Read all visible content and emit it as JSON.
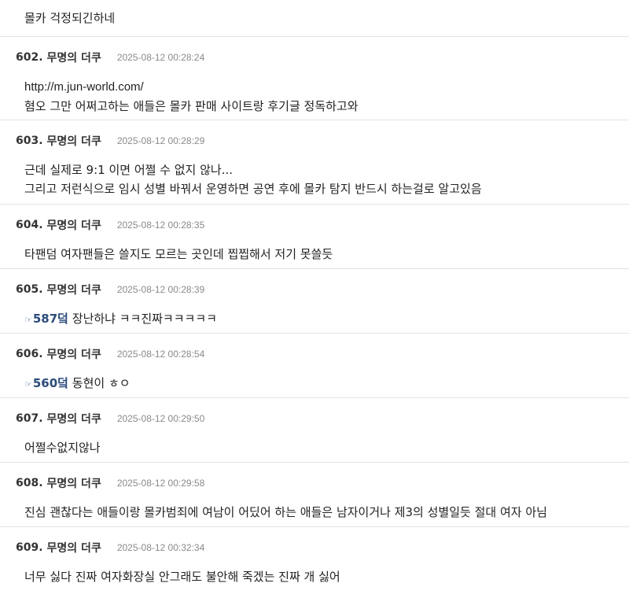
{
  "top_post": {
    "text": "몰카 걱정되긴하네"
  },
  "posts": [
    {
      "number": "602.",
      "author": "무명의 더쿠",
      "time": "2025-08-12 00:28:24",
      "link": "http://m.jun-world.com/",
      "lines": [
        "혐오 그만 어쩌고하는 애들은 몰카 판매 사이트랑 후기글 정독하고와"
      ]
    },
    {
      "number": "603.",
      "author": "무명의 더쿠",
      "time": "2025-08-12 00:28:29",
      "lines": [
        "근데 실제로 9:1 이면 어쩔 수 없지 않나...",
        "그리고 저런식으로 임시 성별 바꿔서 운영하면 공연 후에 몰카 탐지 반드시 하는걸로 알고있음"
      ]
    },
    {
      "number": "604.",
      "author": "무명의 더쿠",
      "time": "2025-08-12 00:28:35",
      "lines": [
        "타팬덤 여자팬들은 쓸지도 모르는 곳인데 찝찝해서 저기 못쓸듯"
      ]
    },
    {
      "number": "605.",
      "author": "무명의 더쿠",
      "time": "2025-08-12 00:28:39",
      "anchor": "587덬",
      "anchor_icon": "pointing-hand-icon",
      "lines": [
        " 장난하냐 ㅋㅋ진짜ㅋㅋㅋㅋㅋ"
      ]
    },
    {
      "number": "606.",
      "author": "무명의 더쿠",
      "time": "2025-08-12 00:28:54",
      "anchor": "560덬",
      "anchor_icon": "pointing-hand-icon",
      "lines": [
        " 동현이 ㅎㅇ"
      ]
    },
    {
      "number": "607.",
      "author": "무명의 더쿠",
      "time": "2025-08-12 00:29:50",
      "lines": [
        "어쩔수없지않나"
      ]
    },
    {
      "number": "608.",
      "author": "무명의 더쿠",
      "time": "2025-08-12 00:29:58",
      "lines": [
        "진심 괜찮다는 애들이랑 몰카범죄에 여남이 어딨어 하는 애들은 남자이거나 제3의 성별일듯 절대 여자 아님"
      ]
    },
    {
      "number": "609.",
      "author": "무명의 더쿠",
      "time": "2025-08-12 00:32:34",
      "lines": [
        "너무 싫다 진짜 여자화장실 안그래도 불안해 죽겠는 진짜 개 싫어"
      ]
    }
  ]
}
